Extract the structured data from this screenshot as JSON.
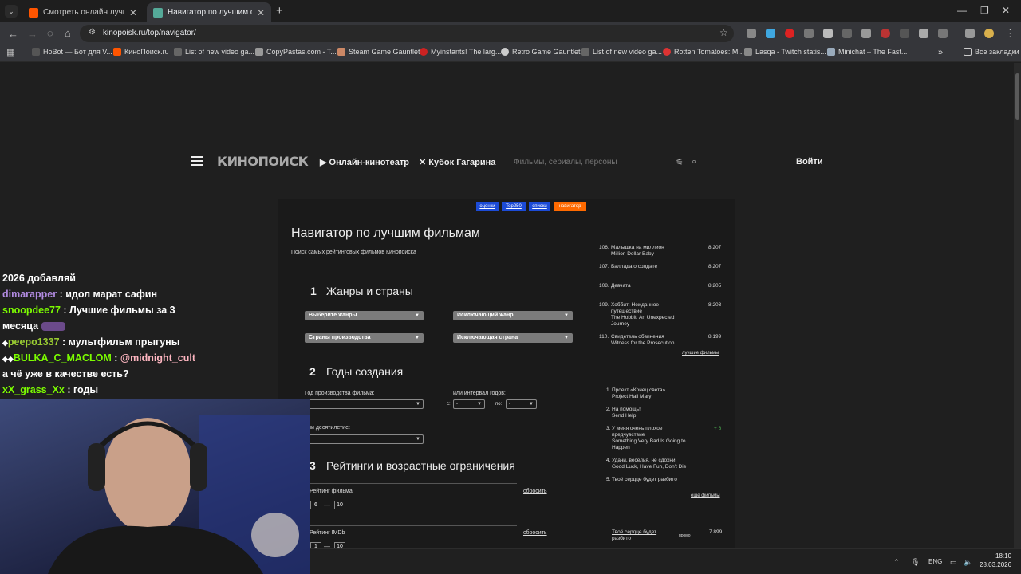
{
  "browser": {
    "tabs": [
      {
        "title": "Смотреть онлайн лучшие фил",
        "active": false
      },
      {
        "title": "Навигатор по лучшим фильм",
        "active": true
      }
    ],
    "url": "kinopoisk.ru/top/navigator/",
    "bookmarks": [
      {
        "label": "HoBot — Бот для V..."
      },
      {
        "label": "КиноПоиск.ru"
      },
      {
        "label": "List of new video ga..."
      },
      {
        "label": "CopyPastas.com - T..."
      },
      {
        "label": "Steam Game Gauntlet"
      },
      {
        "label": "Myinstants! The larg..."
      },
      {
        "label": "Retro Game Gauntlet"
      },
      {
        "label": "List of new video ga..."
      },
      {
        "label": "Rotten Tomatoes: M..."
      },
      {
        "label": "Lasqa - Twitch statis..."
      },
      {
        "label": "Minichat – The Fast..."
      }
    ],
    "all_bookmarks": "Все закладки",
    "more": "»"
  },
  "header": {
    "logo": "КИНОПОИСК",
    "online": "Онлайн-кинотеатр",
    "cup": "Кубок Гагарина",
    "search_placeholder": "Фильмы, сериалы, персоны",
    "login": "Войти"
  },
  "subnav": [
    {
      "label": "оценки"
    },
    {
      "label": "Top250"
    },
    {
      "label": "списки"
    },
    {
      "label": "навигатор"
    }
  ],
  "main": {
    "title": "Навигатор по лучшим фильмам",
    "subtitle": "Поиск самых рейтинговых фильмов Кинопоиска",
    "s1": {
      "num": "1",
      "title": "Жанры и страны",
      "genres": "Выберите жанры",
      "excl_genre": "Исключающий жанр",
      "countries": "Страны производства",
      "excl_country": "Исключающая страна"
    },
    "s2": {
      "num": "2",
      "title": "Годы создания",
      "year_label": "Год производства фильма:",
      "interval_label": "или интервал годов:",
      "from": "с:",
      "to": "по:",
      "dash": "-",
      "decade_label": "или десятилетие:"
    },
    "s3": {
      "num": "3",
      "title": "Рейтинги и возрастные ограничения",
      "film_rating": "Рейтинг фильма",
      "imdb_rating": "Рейтинг IMDb",
      "reset": "сбросить",
      "film_from": "6",
      "film_to": "10",
      "imdb_from": "1",
      "imdb_to": "10",
      "sep": "—"
    }
  },
  "sidebar": {
    "top": [
      {
        "num": "106.",
        "title": "Малышка на миллион",
        "orig": "Million Dollar Baby",
        "score": "8.207"
      },
      {
        "num": "107.",
        "title": "Баллада о солдате",
        "orig": "",
        "score": "8.207"
      },
      {
        "num": "108.",
        "title": "Девчата",
        "orig": "",
        "score": "8.205"
      },
      {
        "num": "109.",
        "title": "Хоббит: Нежданное путешествие",
        "orig": "The Hobbit: An Unexpected Journey",
        "score": "8.203"
      },
      {
        "num": "110.",
        "title": "Свидетель обвинения",
        "orig": "Witness for the Prosecution",
        "score": "8.199"
      }
    ],
    "best_link": "лучшие фильмы",
    "popular": [
      {
        "num": "1.",
        "title": "Проект «Конец света»",
        "orig": "Project Hail Mary",
        "delta": ""
      },
      {
        "num": "2.",
        "title": "На помощь!",
        "orig": "Send Help",
        "delta": ""
      },
      {
        "num": "3.",
        "title": "У меня очень плохое предчувствие",
        "orig": "Something Very Bad Is Going to Happen",
        "delta": "+ 6"
      },
      {
        "num": "4.",
        "title": "Удачи, веселья, не сдохни",
        "orig": "Good Luck, Have Fun, Don't Die",
        "delta": ""
      },
      {
        "num": "5.",
        "title": "Твоё сердце будет разбито",
        "orig": "",
        "delta": ""
      }
    ],
    "more_link": "еще фильмы",
    "promo": {
      "title": "Твоё сердце будет разбито",
      "tag": "промо",
      "score": "7.899"
    }
  },
  "chat": [
    {
      "user": "",
      "text": "2026 добавляй",
      "color": "#ffffff"
    },
    {
      "user": "dimarapper",
      "text": "идол марат сафин",
      "color": "#b18ae0"
    },
    {
      "user": "snoopdee77",
      "text": "Лучшие фильмы за 3",
      "color": "#7cfc00"
    },
    {
      "user": "",
      "text": "месяца",
      "color": "#ffffff"
    },
    {
      "user": "peepo1337",
      "text": "мультфильм прыгуны",
      "color": "#9acd32"
    },
    {
      "user": "BULKA_C_MACLOM",
      "text": "@midnight_cult",
      "color": "#7cfc00"
    },
    {
      "user": "",
      "text": "а чё уже в качестве есть?",
      "color": "#ffffff"
    },
    {
      "user": "xX_grass_Xx",
      "text": "годы",
      "color": "#7cfc00"
    }
  ],
  "tray": {
    "lang": "ENG",
    "time": "18:10",
    "date": "28.03.2026"
  },
  "colors": {
    "accent": "#ff6a00",
    "subnav_blue": "#1c4bd6"
  }
}
